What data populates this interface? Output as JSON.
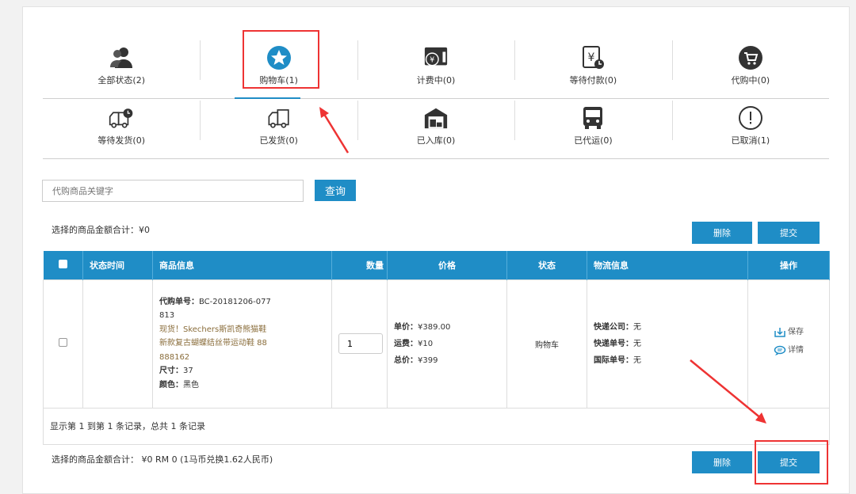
{
  "status_tabs_row1": [
    {
      "label": "全部状态(2)",
      "icon": "users-icon"
    },
    {
      "label": "购物车(1)",
      "icon": "star-icon"
    },
    {
      "label": "计费中(0)",
      "icon": "billing-icon"
    },
    {
      "label": "等待付款(0)",
      "icon": "yen-clock-icon"
    },
    {
      "label": "代购中(0)",
      "icon": "cart-icon"
    }
  ],
  "status_tabs_row2": [
    {
      "label": "等待发货(0)",
      "icon": "truck-clock-icon"
    },
    {
      "label": "已发货(0)",
      "icon": "truck-icon"
    },
    {
      "label": "已入库(0)",
      "icon": "warehouse-icon"
    },
    {
      "label": "已代运(0)",
      "icon": "bus-icon"
    },
    {
      "label": "已取消(1)",
      "icon": "alert-circle-icon"
    }
  ],
  "search": {
    "placeholder": "代购商品关键字",
    "button": "查询"
  },
  "summary_top": "选择的商品金额合计：¥0",
  "buttons": {
    "delete": "删除",
    "submit": "提交"
  },
  "table": {
    "headers": {
      "time": "状态时间",
      "product": "商品信息",
      "qty": "数量",
      "price": "价格",
      "status": "状态",
      "logistics": "物流信息",
      "ops": "操作"
    },
    "row": {
      "order_label": "代购单号：",
      "order_no_line1": "BC-20181206-077",
      "order_no_line2": "813",
      "title_line1": "现货！Skechers斯凯奇熊猫鞋",
      "title_line2": "新款复古蝴蝶结丝带运动鞋 88",
      "title_line3": "888162",
      "size_label": "尺寸：",
      "size": "37",
      "color_label": "颜色：",
      "color": "黑色",
      "qty": "1",
      "unit_price_label": "单价：",
      "unit_price": "¥389.00",
      "shipping_label": "运费：",
      "shipping": "¥10",
      "total_label": "总价：",
      "total": "¥399",
      "status": "购物车",
      "courier_label": "快递公司：",
      "courier": "无",
      "tracking_label": "快递单号：",
      "tracking": "无",
      "intl_label": "国际单号：",
      "intl": "无",
      "op_save": "保存",
      "op_detail": "详情"
    },
    "footer": "显示第 1 到第 1 条记录，总共 1 条记录"
  },
  "summary_bottom": "选择的商品金额合计： ¥0 RM 0 (1马币兑换1.62人民币)",
  "colors": {
    "accent": "#1f8dc6",
    "highlight": "#e33333"
  }
}
